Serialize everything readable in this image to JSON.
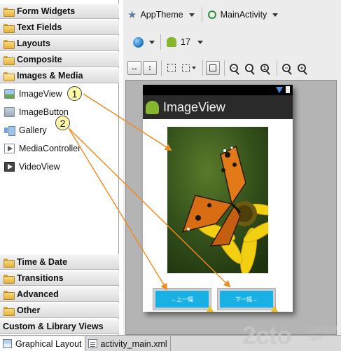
{
  "palette": {
    "categories_top": [
      {
        "label": "Form Widgets",
        "open": false
      },
      {
        "label": "Text Fields",
        "open": false
      },
      {
        "label": "Layouts",
        "open": false
      },
      {
        "label": "Composite",
        "open": false
      },
      {
        "label": "Images & Media",
        "open": true
      }
    ],
    "items": [
      {
        "label": "ImageView",
        "icon": "imageview-icon"
      },
      {
        "label": "ImageButton",
        "icon": "imagebutton-icon"
      },
      {
        "label": "Gallery",
        "icon": "gallery-icon"
      },
      {
        "label": "MediaController",
        "icon": "mediacontroller-icon"
      },
      {
        "label": "VideoView",
        "icon": "videoview-icon"
      }
    ],
    "categories_bottom": [
      {
        "label": "Time & Date"
      },
      {
        "label": "Transitions"
      },
      {
        "label": "Advanced"
      },
      {
        "label": "Other"
      }
    ],
    "custom_views_label": "Custom & Library Views"
  },
  "toolbar": {
    "theme": "AppTheme",
    "activity": "MainActivity",
    "api_level": "17",
    "globe_icon": "globe-icon",
    "android_icon": "android-icon"
  },
  "preview": {
    "app_title": "ImageView",
    "button_left": "←上一幅",
    "button_right": "下一幅→"
  },
  "tabs": [
    {
      "label": "Graphical Layout",
      "active": true
    },
    {
      "label": "activity_main.xml",
      "active": false
    }
  ],
  "annotations": {
    "callout_1": "1",
    "callout_2": "2",
    "arrow_color": "#f08a1c"
  },
  "watermark": {
    "main": "2cto",
    "suffix": ".com",
    "cn": "红黑联盟"
  }
}
